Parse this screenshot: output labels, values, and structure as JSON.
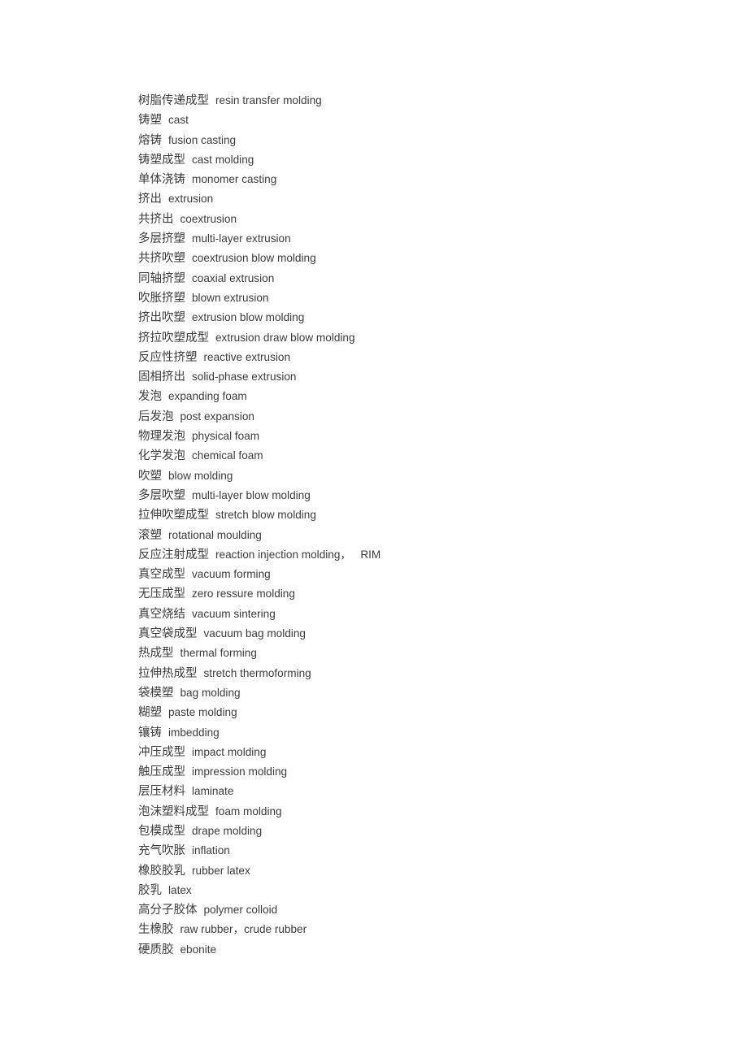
{
  "document": {
    "type": "bilingual-glossary",
    "subject": "plastics and rubber processing terminology",
    "text_color": "#3c3c3c",
    "background_color": "#ffffff",
    "entries": [
      {
        "term": "树脂传递成型",
        "gloss": "resin transfer molding"
      },
      {
        "term": "铸塑",
        "gloss": "cast"
      },
      {
        "term": "熔铸",
        "gloss": "fusion casting"
      },
      {
        "term": "铸塑成型",
        "gloss": "cast molding"
      },
      {
        "term": "单体浇铸",
        "gloss": "monomer casting"
      },
      {
        "term": "挤出",
        "gloss": "extrusion"
      },
      {
        "term": "共挤出",
        "gloss": "coextrusion"
      },
      {
        "term": "多层挤塑",
        "gloss": "multi-layer extrusion"
      },
      {
        "term": "共挤吹塑",
        "gloss": "coextrusion blow molding"
      },
      {
        "term": "同轴挤塑",
        "gloss": "coaxial extrusion"
      },
      {
        "term": "吹胀挤塑",
        "gloss": "blown extrusion"
      },
      {
        "term": "挤出吹塑",
        "gloss": "extrusion blow molding"
      },
      {
        "term": "挤拉吹塑成型",
        "gloss": "extrusion draw blow molding"
      },
      {
        "term": "反应性挤塑",
        "gloss": "reactive extrusion"
      },
      {
        "term": "固相挤出",
        "gloss": "solid-phase extrusion"
      },
      {
        "term": "发泡",
        "gloss": "expanding foam"
      },
      {
        "term": "后发泡",
        "gloss": "post expansion"
      },
      {
        "term": "物理发泡",
        "gloss": "physical foam"
      },
      {
        "term": "化学发泡",
        "gloss": "chemical foam"
      },
      {
        "term": "吹塑",
        "gloss": "blow molding"
      },
      {
        "term": "多层吹塑",
        "gloss": "multi-layer blow molding"
      },
      {
        "term": "拉伸吹塑成型",
        "gloss": "stretch blow molding"
      },
      {
        "term": "滚塑",
        "gloss": "rotational moulding"
      },
      {
        "term": "反应注射成型",
        "gloss": "reaction injection molding，   RIM"
      },
      {
        "term": "真空成型",
        "gloss": "vacuum forming"
      },
      {
        "term": "无压成型",
        "gloss": "zero ressure molding"
      },
      {
        "term": "真空烧结",
        "gloss": "vacuum sintering"
      },
      {
        "term": "真空袋成型",
        "gloss": "vacuum bag molding"
      },
      {
        "term": "热成型",
        "gloss": "thermal forming"
      },
      {
        "term": "拉伸热成型",
        "gloss": "stretch thermoforming"
      },
      {
        "term": "袋模塑",
        "gloss": "bag molding"
      },
      {
        "term": "糊塑",
        "gloss": "paste molding"
      },
      {
        "term": "镶铸",
        "gloss": "imbedding"
      },
      {
        "term": "冲压成型",
        "gloss": "impact molding"
      },
      {
        "term": "触压成型",
        "gloss": "impression molding"
      },
      {
        "term": "层压材料",
        "gloss": "laminate"
      },
      {
        "term": "泡沫塑料成型",
        "gloss": "foam molding"
      },
      {
        "term": "包模成型",
        "gloss": "drape molding"
      },
      {
        "term": "充气吹胀",
        "gloss": "inflation"
      },
      {
        "term": "橡胶胶乳",
        "gloss": "rubber latex"
      },
      {
        "term": "胶乳",
        "gloss": "latex"
      },
      {
        "term": "高分子胶体",
        "gloss": "polymer colloid"
      },
      {
        "term": "生橡胶",
        "gloss": "raw rubber，crude rubber"
      },
      {
        "term": "硬质胶",
        "gloss": "ebonite"
      }
    ]
  }
}
